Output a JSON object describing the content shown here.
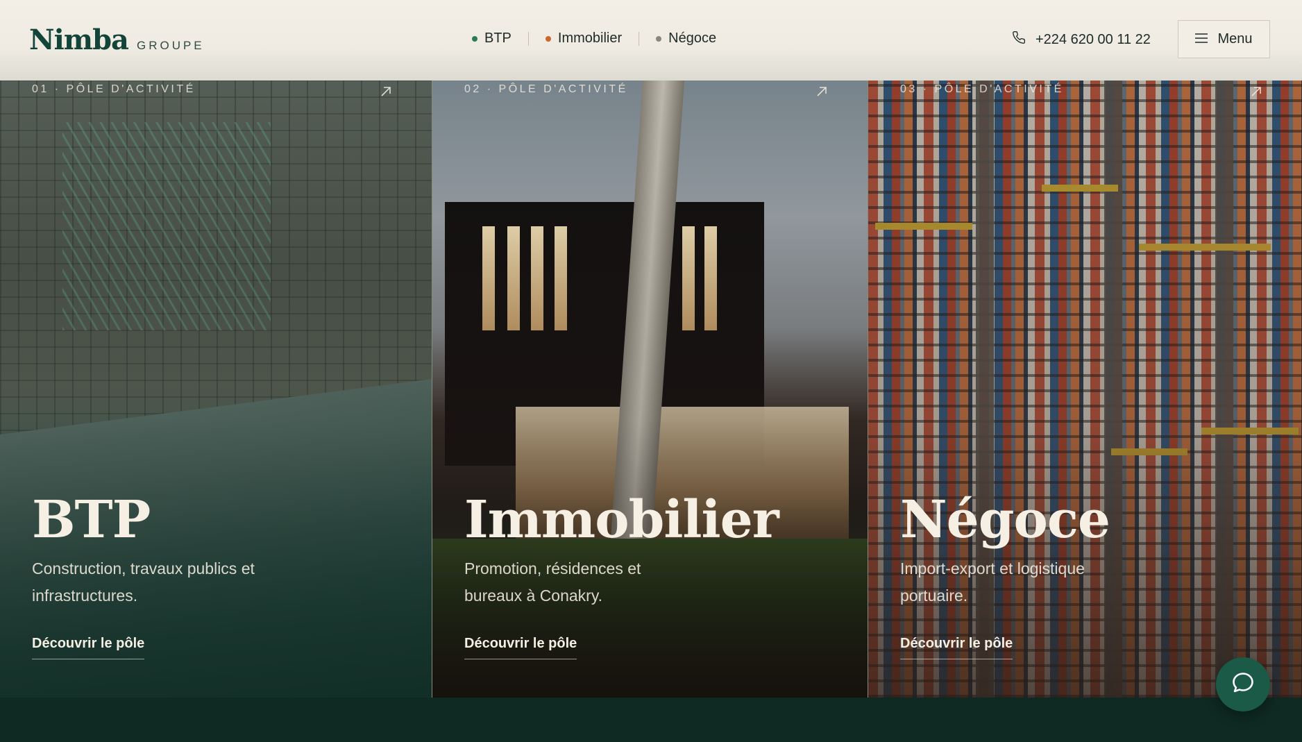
{
  "header": {
    "logo": {
      "word": "Nimba",
      "sub": "GROUPE"
    },
    "nav": [
      {
        "label": "BTP",
        "dot_color": "#2d7a5a"
      },
      {
        "label": "Immobilier",
        "dot_color": "#c8672f"
      },
      {
        "label": "Négoce",
        "dot_color": "#8a8780"
      }
    ],
    "phone": "+224 620 00 11 22",
    "menu_label": "Menu"
  },
  "panels": [
    {
      "kicker": "01 · PÔLE D'ACTIVITÉ",
      "title": "BTP",
      "description": "Construction, travaux publics et infrastructures.",
      "cta": "Découvrir le pôle"
    },
    {
      "kicker": "02 · PÔLE D'ACTIVITÉ",
      "title": "Immobilier",
      "description": "Promotion, résidences et bureaux à Conakry.",
      "cta": "Découvrir le pôle"
    },
    {
      "kicker": "03 · PÔLE D'ACTIVITÉ",
      "title": "Négoce",
      "description": "Import-export et logistique portuaire.",
      "cta": "Découvrir le pôle"
    }
  ],
  "colors": {
    "brand_green": "#12443a",
    "footer": "#0e2a22",
    "chat": "#1b5a47"
  }
}
